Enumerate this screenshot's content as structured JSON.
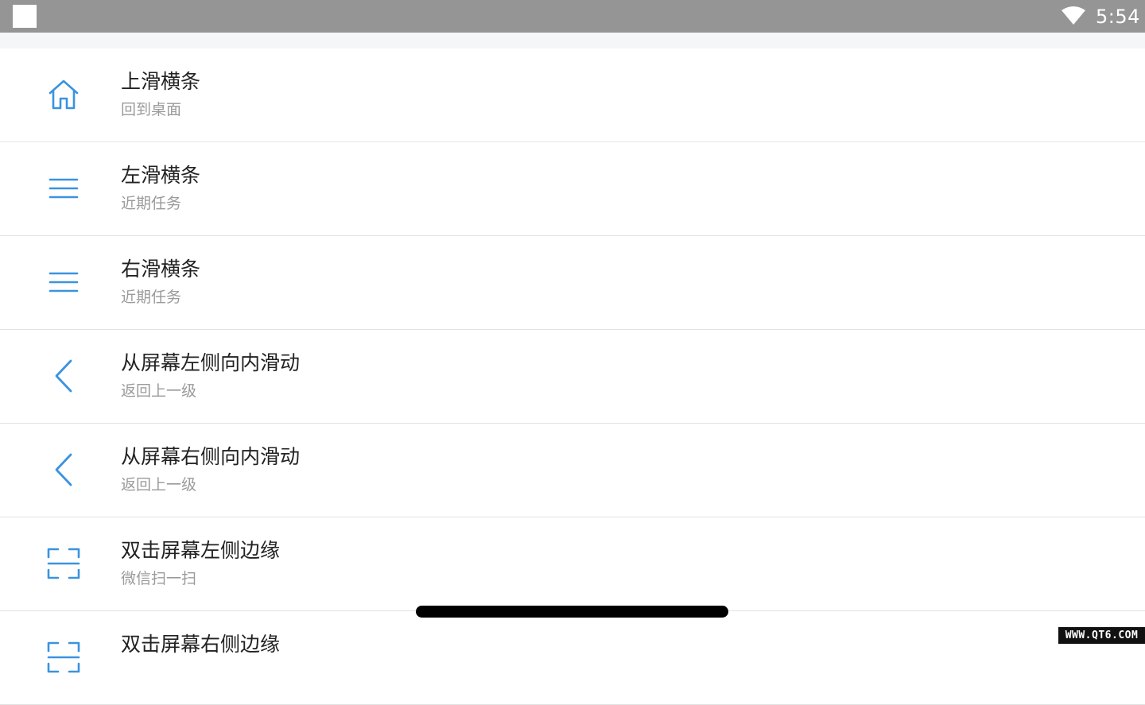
{
  "status_bar": {
    "time": "5:54",
    "notification_icon": "square-notification-icon",
    "wifi_icon": "wifi-icon"
  },
  "colors": {
    "accent": "#3a93e0",
    "status_bar_bg": "#959595",
    "title_text": "#222222",
    "subtitle_text": "#9a9a9a",
    "divider": "#e2e2e2"
  },
  "gestures": [
    {
      "icon": "home-icon",
      "title": "上滑横条",
      "subtitle": "回到桌面"
    },
    {
      "icon": "menu-icon",
      "title": "左滑横条",
      "subtitle": "近期任务"
    },
    {
      "icon": "menu-icon",
      "title": "右滑横条",
      "subtitle": "近期任务"
    },
    {
      "icon": "chevron-left-icon",
      "title": "从屏幕左侧向内滑动",
      "subtitle": "返回上一级"
    },
    {
      "icon": "chevron-left-icon",
      "title": "从屏幕右侧向内滑动",
      "subtitle": "返回上一级"
    },
    {
      "icon": "scan-icon",
      "title": "双击屏幕左侧边缘",
      "subtitle": "微信扫一扫"
    },
    {
      "icon": "scan-icon",
      "title": "双击屏幕右侧边缘",
      "subtitle": ""
    }
  ],
  "watermark": "WWW.QT6.COM"
}
